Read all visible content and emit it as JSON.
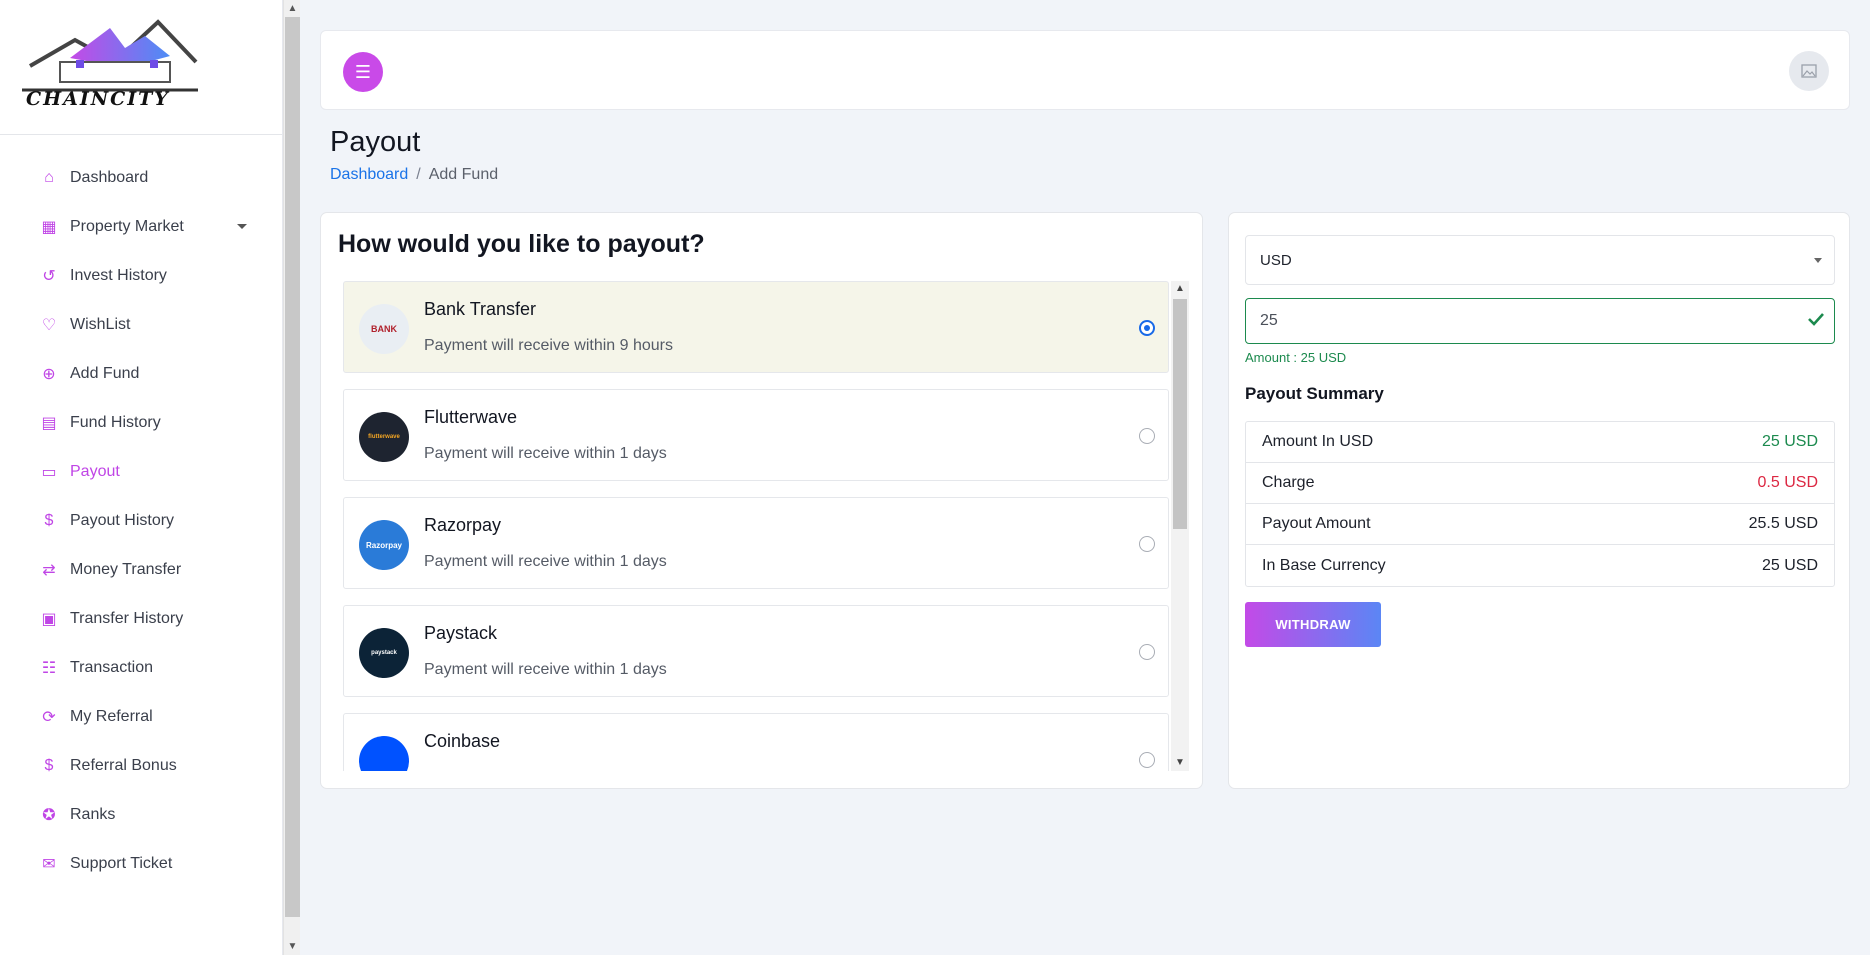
{
  "brand": {
    "logo_text": "CHAINCITY"
  },
  "sidebar": {
    "items": [
      {
        "label": "Dashboard",
        "icon": "home-icon"
      },
      {
        "label": "Property Market",
        "icon": "property-icon"
      },
      {
        "label": "Invest History",
        "icon": "history-icon"
      },
      {
        "label": "WishList",
        "icon": "heart-icon"
      },
      {
        "label": "Add Fund",
        "icon": "add-fund-icon"
      },
      {
        "label": "Fund History",
        "icon": "receipt-icon"
      },
      {
        "label": "Payout",
        "icon": "card-icon"
      },
      {
        "label": "Payout History",
        "icon": "dollar-doc-icon"
      },
      {
        "label": "Money Transfer",
        "icon": "transfer-icon"
      },
      {
        "label": "Transfer History",
        "icon": "cash-icon"
      },
      {
        "label": "Transaction",
        "icon": "id-card-icon"
      },
      {
        "label": "My Referral",
        "icon": "refresh-icon"
      },
      {
        "label": "Referral Bonus",
        "icon": "hand-coin-icon"
      },
      {
        "label": "Ranks",
        "icon": "badge-icon"
      },
      {
        "label": "Support Ticket",
        "icon": "ticket-icon"
      }
    ],
    "active_index": 6
  },
  "topbar": {
    "menu_icon": "menu-icon",
    "avatar_icon": "image-placeholder-icon"
  },
  "page": {
    "title": "Payout"
  },
  "breadcrumb": {
    "home": "Dashboard",
    "separator": "/",
    "current": "Add Fund"
  },
  "payout": {
    "heading": "How would you like to payout?",
    "methods": [
      {
        "name": "Bank Transfer",
        "desc": "Payment will receive within 9 hours",
        "selected": true,
        "logo": "BANK"
      },
      {
        "name": "Flutterwave",
        "desc": "Payment will receive within 1 days",
        "selected": false,
        "logo": "flutterwave"
      },
      {
        "name": "Razorpay",
        "desc": "Payment will receive within 1 days",
        "selected": false,
        "logo": "Razorpay"
      },
      {
        "name": "Paystack",
        "desc": "Payment will receive within 1 days",
        "selected": false,
        "logo": "paystack"
      },
      {
        "name": "Coinbase",
        "desc": "",
        "selected": false,
        "logo": ""
      }
    ]
  },
  "form": {
    "currency": "USD",
    "amount": "25",
    "amount_hint": "Amount : 25 USD",
    "summary_title": "Payout Summary",
    "summary": [
      {
        "label": "Amount In USD",
        "value": "25 USD",
        "color": "#1c8a4e"
      },
      {
        "label": "Charge",
        "value": "0.5 USD",
        "color": "#dc2742"
      },
      {
        "label": "Payout Amount",
        "value": "25.5 USD",
        "color": "#1d212b"
      },
      {
        "label": "In Base Currency",
        "value": "25 USD",
        "color": "#1d212b"
      }
    ],
    "withdraw_label": "WITHDRAW"
  },
  "colors": {
    "accent": "#c94ae8",
    "link": "#1a73e8",
    "success": "#1c8a4e",
    "danger": "#dc2742"
  }
}
